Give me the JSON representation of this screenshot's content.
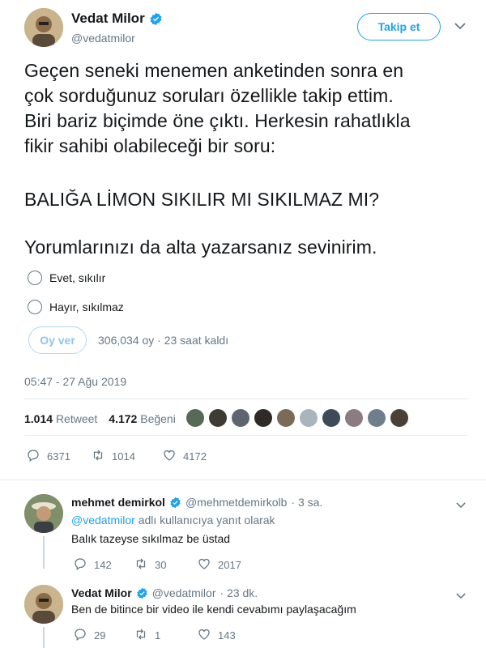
{
  "tweet": {
    "author_name": "Vedat Milor",
    "author_handle": "@vedatmilor",
    "follow_label": "Takip et",
    "text_lines": [
      "Geçen seneki menemen anketinden sonra en",
      "çok sorduğunuz soruları özellikle takip ettim.",
      "Biri bariz biçimde öne çıktı. Herkesin rahatlıkla",
      "fikir sahibi olabileceği bir soru:",
      "BALIĞA LİMON SIKILIR MI SIKILMAZ MI?",
      "Yorumlarınızı da alta yazarsanız sevinirim."
    ],
    "poll": {
      "options": [
        "Evet, sıkılır",
        "Hayır, sıkılmaz"
      ],
      "vote_label": "Oy ver",
      "meta": "306,034 oy · 23 saat kaldı"
    },
    "timestamp": "05:47 - 27 Ağu 2019",
    "retweets_count": "1.014",
    "retweets_label": "Retweet",
    "likes_count": "4.172",
    "likes_label": "Beğeni",
    "actions": {
      "replies": "6371",
      "retweets": "1014",
      "likes": "4172"
    }
  },
  "replies": [
    {
      "name": "mehmet demirkol",
      "handle": "@mehmetdemirkolb",
      "time": "· 3 sa.",
      "reply_to_prefix": "@vedatmilor",
      "reply_to_suffix": "adlı kullanıcıya yanıt olarak",
      "text": "Balık tazeyse sıkılmaz be üstad",
      "actions": {
        "replies": "142",
        "retweets": "30",
        "likes": "2017"
      }
    },
    {
      "name": "Vedat Milor",
      "handle": "@vedatmilor",
      "time": "· 23 dk.",
      "text": "Ben de bitince bir video ile kendi cevabımı paylaşacağım",
      "actions": {
        "replies": "29",
        "retweets": "1",
        "likes": "143"
      }
    }
  ],
  "colors": {
    "accent": "#1da1f2",
    "text": "#14171a",
    "muted": "#657786",
    "border": "#e6ecf0"
  },
  "icons": [
    "verified-badge-icon",
    "chevron-down-icon",
    "reply-icon",
    "retweet-icon",
    "like-icon"
  ]
}
